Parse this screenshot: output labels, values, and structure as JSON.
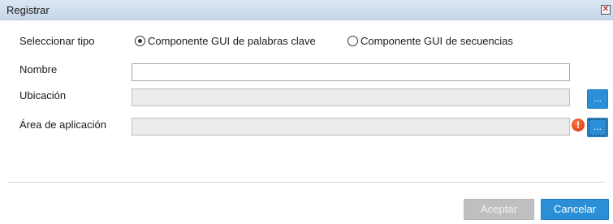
{
  "dialog": {
    "title": "Registrar",
    "close_glyph": "✕"
  },
  "form": {
    "type_label": "Seleccionar tipo",
    "type_options": [
      {
        "label": "Componente GUI de palabras clave",
        "selected": true
      },
      {
        "label": "Componente GUI de secuencias",
        "selected": false
      }
    ],
    "name_label": "Nombre",
    "name_value": "",
    "location_label": "Ubicación",
    "location_value": "",
    "location_browse": "...",
    "area_label": "Área de aplicación",
    "area_value": "",
    "area_browse": "...",
    "area_error_glyph": "!"
  },
  "buttons": {
    "ok": "Aceptar",
    "cancel": "Cancelar"
  },
  "colors": {
    "accent": "#2a8fd7",
    "disabled_button": "#bfbfbf",
    "error": "#d52b00"
  }
}
